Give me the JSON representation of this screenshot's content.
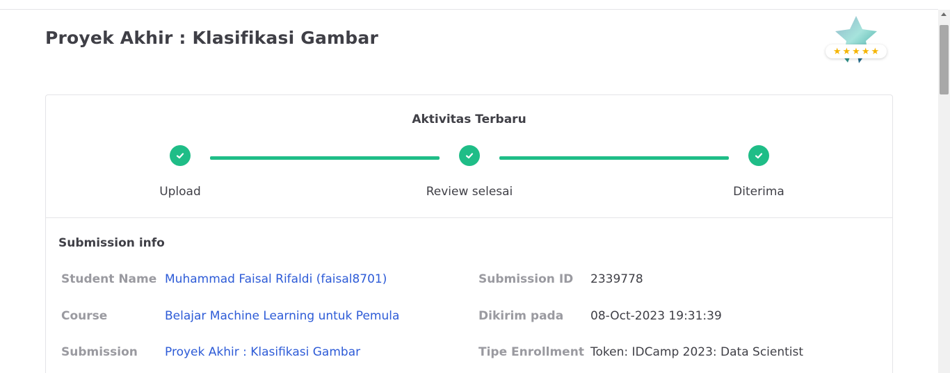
{
  "page": {
    "title": "Proyek Akhir : Klasifikasi Gambar"
  },
  "badge": {
    "icon": "star-badge-icon",
    "stars": [
      "★",
      "★",
      "★",
      "★",
      "★"
    ],
    "rating": 5
  },
  "activity": {
    "title": "Aktivitas Terbaru",
    "steps": [
      {
        "label": "Upload",
        "done": true
      },
      {
        "label": "Review selesai",
        "done": true
      },
      {
        "label": "Diterima",
        "done": true
      }
    ],
    "accent_color": "#1fbd87"
  },
  "submission_info": {
    "title": "Submission info",
    "left": [
      {
        "label": "Student Name",
        "value": "Muhammad Faisal Rifaldi (faisal8701)"
      },
      {
        "label": "Course",
        "value": "Belajar Machine Learning untuk Pemula"
      },
      {
        "label": "Submission",
        "value": "Proyek Akhir : Klasifikasi Gambar"
      }
    ],
    "right": [
      {
        "label": "Submission ID",
        "value": "2339778"
      },
      {
        "label": "Dikirim pada",
        "value": "08-Oct-2023 19:31:39"
      },
      {
        "label": "Tipe Enrollment",
        "value": "Token: IDCamp 2023: Data Scientist"
      }
    ]
  }
}
